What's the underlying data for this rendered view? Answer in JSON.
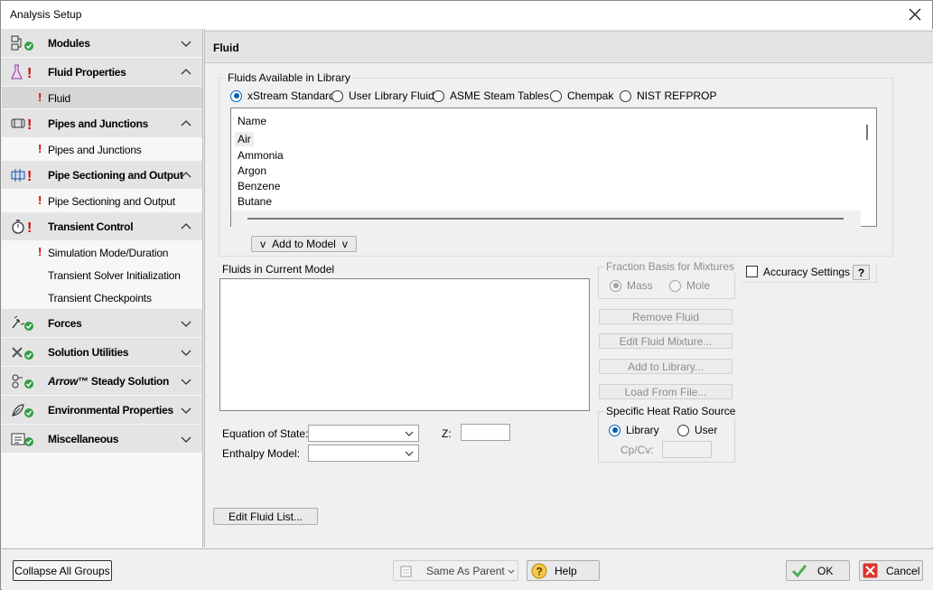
{
  "window": {
    "title": "Analysis Setup"
  },
  "sidebar": {
    "groups": [
      {
        "label": "Modules",
        "icon": "modules-icon",
        "status": "ok",
        "expanded": false
      },
      {
        "label": "Fluid Properties",
        "icon": "flask-icon",
        "status": "error",
        "expanded": true,
        "items": [
          {
            "label": "Fluid",
            "status": "error",
            "selected": true
          }
        ]
      },
      {
        "label": "Pipes and Junctions",
        "icon": "pipe-icon",
        "status": "error",
        "expanded": true,
        "items": [
          {
            "label": "Pipes and Junctions",
            "status": "error"
          }
        ]
      },
      {
        "label": "Pipe Sectioning and Output",
        "icon": "pipe-section-icon",
        "status": "error",
        "expanded": true,
        "items": [
          {
            "label": "Pipe Sectioning and Output",
            "status": "error"
          }
        ]
      },
      {
        "label": "Transient Control",
        "icon": "stopwatch-icon",
        "status": "error",
        "expanded": true,
        "items": [
          {
            "label": "Simulation Mode/Duration",
            "status": "error"
          },
          {
            "label": "Transient Solver Initialization",
            "status": "none"
          },
          {
            "label": "Transient Checkpoints",
            "status": "none"
          }
        ]
      },
      {
        "label": "Forces",
        "icon": "forces-icon",
        "status": "ok",
        "expanded": false
      },
      {
        "label": "Solution Utilities",
        "icon": "tools-icon",
        "status": "ok",
        "expanded": false
      },
      {
        "label": "™ Steady Solution",
        "brand": "Arrow",
        "icon": "steady-solution-icon",
        "status": "ok",
        "expanded": false
      },
      {
        "label": "Environmental Properties",
        "icon": "environment-icon",
        "status": "ok",
        "expanded": false
      },
      {
        "label": "Miscellaneous",
        "icon": "misc-icon",
        "status": "ok",
        "expanded": false
      }
    ]
  },
  "main": {
    "header": "Fluid",
    "library": {
      "legend": "Fluids Available in Library",
      "sources": [
        "xStream Standard",
        "User Library Fluid",
        "ASME Steam Tables",
        "Chempak",
        "NIST REFPROP"
      ],
      "selected_source": 0,
      "column": "Name",
      "fluids": [
        "Air",
        "Ammonia",
        "Argon",
        "Benzene",
        "Butane"
      ],
      "add_button": "Add to Model",
      "add_button_chevron": "v"
    },
    "current": {
      "label": "Fluids in Current Model"
    },
    "fraction": {
      "legend": "Fraction Basis for Mixtures",
      "options": [
        "Mass",
        "Mole"
      ],
      "selected": 0
    },
    "accuracy": {
      "label": "Accuracy Settings",
      "help": "?"
    },
    "actions": [
      "Remove Fluid",
      "Edit Fluid Mixture...",
      "Add to Library...",
      "Load From File..."
    ],
    "heat_ratio": {
      "legend": "Specific Heat Ratio Source",
      "options": [
        "Library",
        "User"
      ],
      "selected": 0,
      "cpcv_label": "Cp/Cv:"
    },
    "equation_of_state_label": "Equation of State:",
    "enthalpy_model_label": "Enthalpy Model:",
    "z_label": "Z:",
    "edit_list_button": "Edit Fluid List..."
  },
  "footer": {
    "collapse_button": "Collapse All Groups",
    "same_as_parent": "Same As Parent",
    "help": "Help",
    "ok": "OK",
    "cancel": "Cancel"
  },
  "colors": {
    "error": "#d40000",
    "ok": "#2f9e44",
    "accent": "#005fb8"
  }
}
